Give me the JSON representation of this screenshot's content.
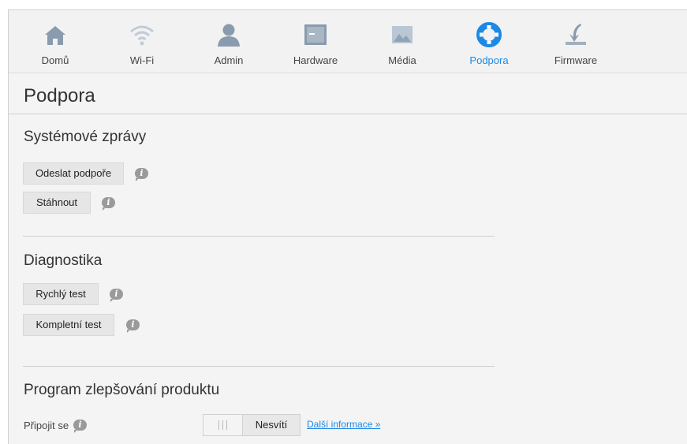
{
  "nav": {
    "items": [
      {
        "label": "Domů",
        "icon": "home-icon"
      },
      {
        "label": "Wi-Fi",
        "icon": "wifi-icon"
      },
      {
        "label": "Admin",
        "icon": "user-icon"
      },
      {
        "label": "Hardware",
        "icon": "hardware-icon"
      },
      {
        "label": "Média",
        "icon": "media-icon"
      },
      {
        "label": "Podpora",
        "icon": "lifebuoy-icon"
      },
      {
        "label": "Firmware",
        "icon": "download-icon"
      }
    ],
    "active": "Podpora",
    "active_color": "#1e88e5"
  },
  "page": {
    "title": "Podpora"
  },
  "system_messages": {
    "title": "Systémové zprávy",
    "send_support_label": "Odeslat podpoře",
    "download_label": "Stáhnout"
  },
  "diagnostics": {
    "title": "Diagnostika",
    "quick_test_label": "Rychlý test",
    "full_test_label": "Kompletní test"
  },
  "improvement_program": {
    "title": "Program zlepšování produktu",
    "join_label": "Připojit se",
    "toggle_state": "Nesvítí",
    "more_info_link": "Další informace »"
  }
}
